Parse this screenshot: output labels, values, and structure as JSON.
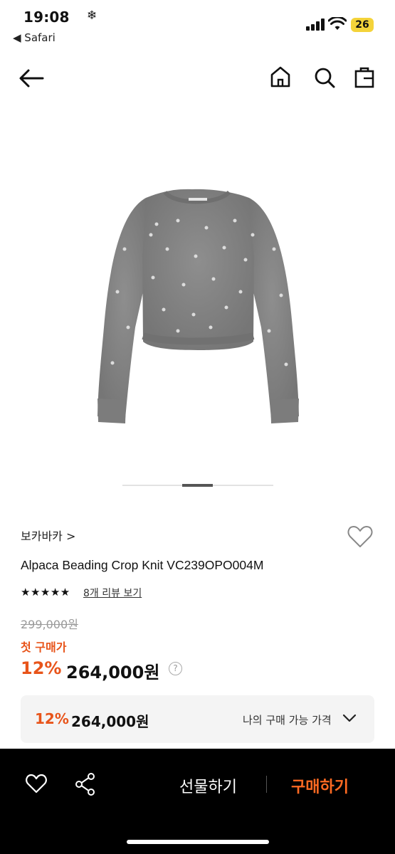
{
  "status_bar": {
    "time": "19:08",
    "snow": "❄",
    "back_app": "◀ Safari",
    "battery": "26"
  },
  "product": {
    "brand": "보카바카 >",
    "title": "Alpaca Beading Crop Knit VC239OPO004M",
    "stars": "★★★★★",
    "review_link": "8개 리뷰 보기",
    "original_price": "299,000원",
    "first_purchase_label": "첫 구매가",
    "discount_percent": "12%",
    "sale_price": "264,000원",
    "help_symbol": "?"
  },
  "my_price": {
    "discount_percent": "12%",
    "price": "264,000원",
    "label": "나의 구매 가능 가격"
  },
  "bottom_bar": {
    "gift_label": "선물하기",
    "buy_label": "구매하기"
  },
  "colors": {
    "accent": "#e8541a",
    "buy": "#ff6a22",
    "sweater": "#8a8a8a"
  }
}
